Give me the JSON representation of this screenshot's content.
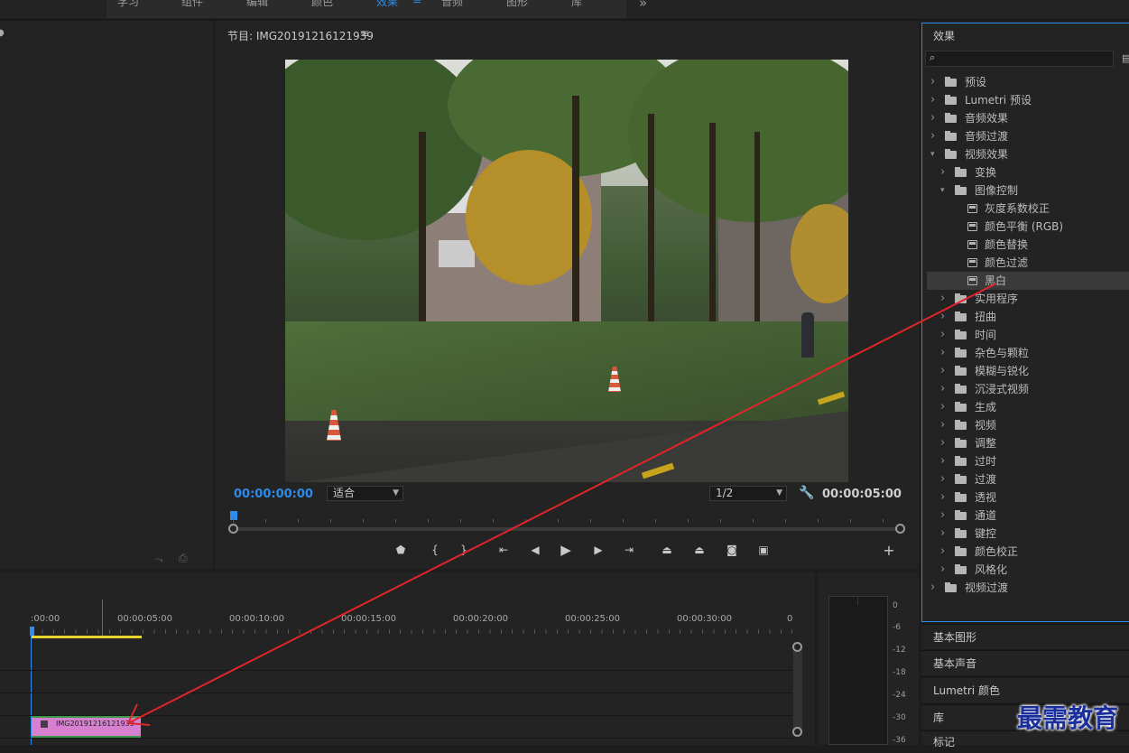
{
  "workspaces": [
    "学习",
    "组件",
    "编辑",
    "颜色",
    "效果",
    "音频",
    "图形",
    "库"
  ],
  "active_workspace": "效果",
  "more_glyph": "»",
  "menu_glyph": "≡",
  "program": {
    "title": "节目: IMG20191216121939",
    "timecode_in": "00:00:00:00",
    "fit": "适合",
    "resolution": "1/2",
    "timecode_out": "00:00:05:00"
  },
  "effects_panel": {
    "title": "效果",
    "search_placeholder": "",
    "items": [
      {
        "label": "预设",
        "level": 0,
        "kind": "preset-folder",
        "expanded": false
      },
      {
        "label": "Lumetri 预设",
        "level": 0,
        "kind": "preset-folder",
        "expanded": false
      },
      {
        "label": "音频效果",
        "level": 0,
        "kind": "folder",
        "expanded": false
      },
      {
        "label": "音频过渡",
        "level": 0,
        "kind": "folder",
        "expanded": false
      },
      {
        "label": "视频效果",
        "level": 0,
        "kind": "folder",
        "expanded": true
      },
      {
        "label": "变换",
        "level": 1,
        "kind": "folder",
        "expanded": false
      },
      {
        "label": "图像控制",
        "level": 1,
        "kind": "folder",
        "expanded": true
      },
      {
        "label": "灰度系数校正",
        "level": 2,
        "kind": "effect"
      },
      {
        "label": "颜色平衡 (RGB)",
        "level": 2,
        "kind": "effect"
      },
      {
        "label": "颜色替换",
        "level": 2,
        "kind": "effect"
      },
      {
        "label": "颜色过滤",
        "level": 2,
        "kind": "effect"
      },
      {
        "label": "黑白",
        "level": 2,
        "kind": "effect",
        "selected": true
      },
      {
        "label": "实用程序",
        "level": 1,
        "kind": "folder",
        "expanded": false
      },
      {
        "label": "扭曲",
        "level": 1,
        "kind": "folder",
        "expanded": false
      },
      {
        "label": "时间",
        "level": 1,
        "kind": "folder",
        "expanded": false
      },
      {
        "label": "杂色与颗粒",
        "level": 1,
        "kind": "folder",
        "expanded": false
      },
      {
        "label": "模糊与锐化",
        "level": 1,
        "kind": "folder",
        "expanded": false
      },
      {
        "label": "沉浸式视频",
        "level": 1,
        "kind": "folder",
        "expanded": false
      },
      {
        "label": "生成",
        "level": 1,
        "kind": "folder",
        "expanded": false
      },
      {
        "label": "视频",
        "level": 1,
        "kind": "folder",
        "expanded": false
      },
      {
        "label": "调整",
        "level": 1,
        "kind": "folder",
        "expanded": false
      },
      {
        "label": "过时",
        "level": 1,
        "kind": "folder",
        "expanded": false
      },
      {
        "label": "过渡",
        "level": 1,
        "kind": "folder",
        "expanded": false
      },
      {
        "label": "透视",
        "level": 1,
        "kind": "folder",
        "expanded": false
      },
      {
        "label": "通道",
        "level": 1,
        "kind": "folder",
        "expanded": false
      },
      {
        "label": "键控",
        "level": 1,
        "kind": "folder",
        "expanded": false
      },
      {
        "label": "颜色校正",
        "level": 1,
        "kind": "folder",
        "expanded": false
      },
      {
        "label": "风格化",
        "level": 1,
        "kind": "folder",
        "expanded": false
      },
      {
        "label": "视频过渡",
        "level": 0,
        "kind": "folder",
        "expanded": false
      }
    ]
  },
  "right_stack": [
    "基本图形",
    "基本声音",
    "Lumetri 颜色",
    "库",
    "标记"
  ],
  "timeline": {
    "ruler": [
      ":00:00",
      "00:00:05:00",
      "00:00:10:00",
      "00:00:15:00",
      "00:00:20:00",
      "00:00:25:00",
      "00:00:30:00",
      "0"
    ],
    "clip_name": "IMG20191216121939"
  },
  "meter_scale": [
    "0",
    "-6",
    "-12",
    "-18",
    "-24",
    "-30",
    "-36"
  ],
  "watermark": "最需教育",
  "colors": {
    "accent": "#2d8ceb",
    "clip": "#d77fd0",
    "annotation": "#e0252a"
  }
}
